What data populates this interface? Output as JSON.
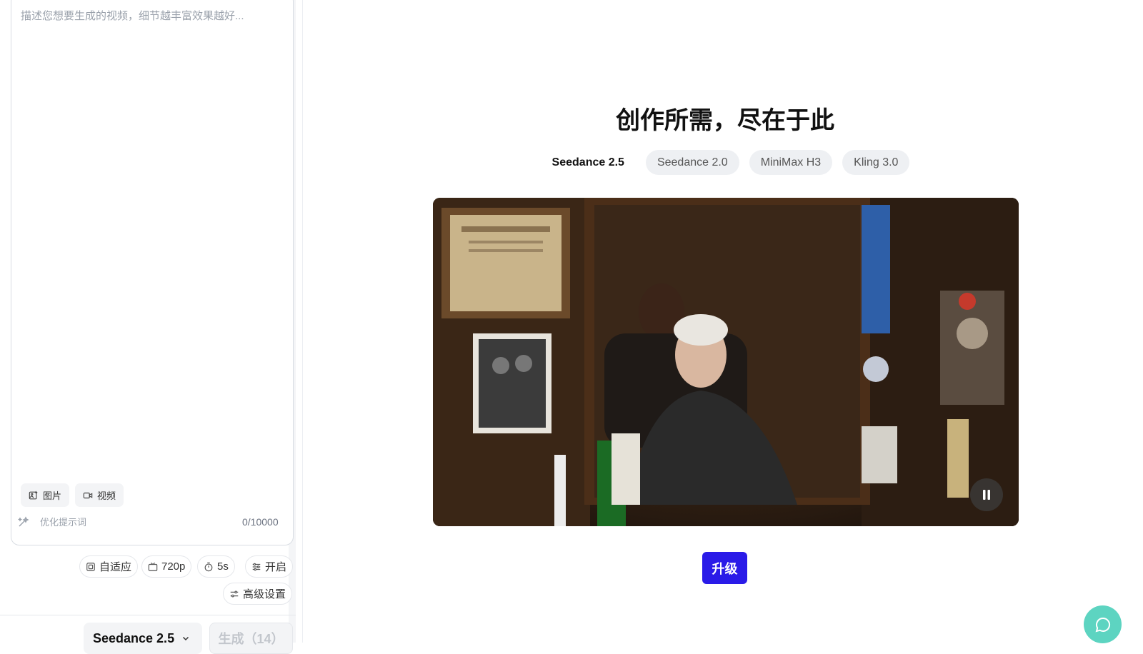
{
  "prompt": {
    "placeholder": "描述您想要生成的视频，细节越丰富效果越好...",
    "attach_image_label": "图片",
    "attach_video_label": "视频",
    "optimize_label": "优化提示词",
    "char_counter": "0/10000"
  },
  "settings": {
    "aspect_label": "自适应",
    "resolution_label": "720p",
    "duration_label": "5s",
    "toggle_label": "开启",
    "advanced_label": "高级设置"
  },
  "footer": {
    "model_selected": "Seedance 2.5",
    "generate_label": "生成（14）"
  },
  "hero": {
    "title": "创作所需，尽在于此",
    "tabs": [
      {
        "label": "Seedance 2.5",
        "active": true
      },
      {
        "label": "Seedance 2.0",
        "active": false
      },
      {
        "label": "MiniMax H3",
        "active": false
      },
      {
        "label": "Kling 3.0",
        "active": false
      }
    ],
    "upgrade_label": "升级"
  },
  "icons": {
    "image": "image-icon",
    "video": "video-icon",
    "optimize": "magic-wand-icon",
    "aspect": "aspect-icon",
    "resolution": "resolution-icon",
    "duration": "timer-icon",
    "toggle": "sliders-icon",
    "advanced": "settings-icon",
    "pause": "pause-icon",
    "chat": "chat-icon"
  },
  "colors": {
    "upgrade_button": "#2a1be8",
    "chat_fab": "#5dd4c1"
  }
}
